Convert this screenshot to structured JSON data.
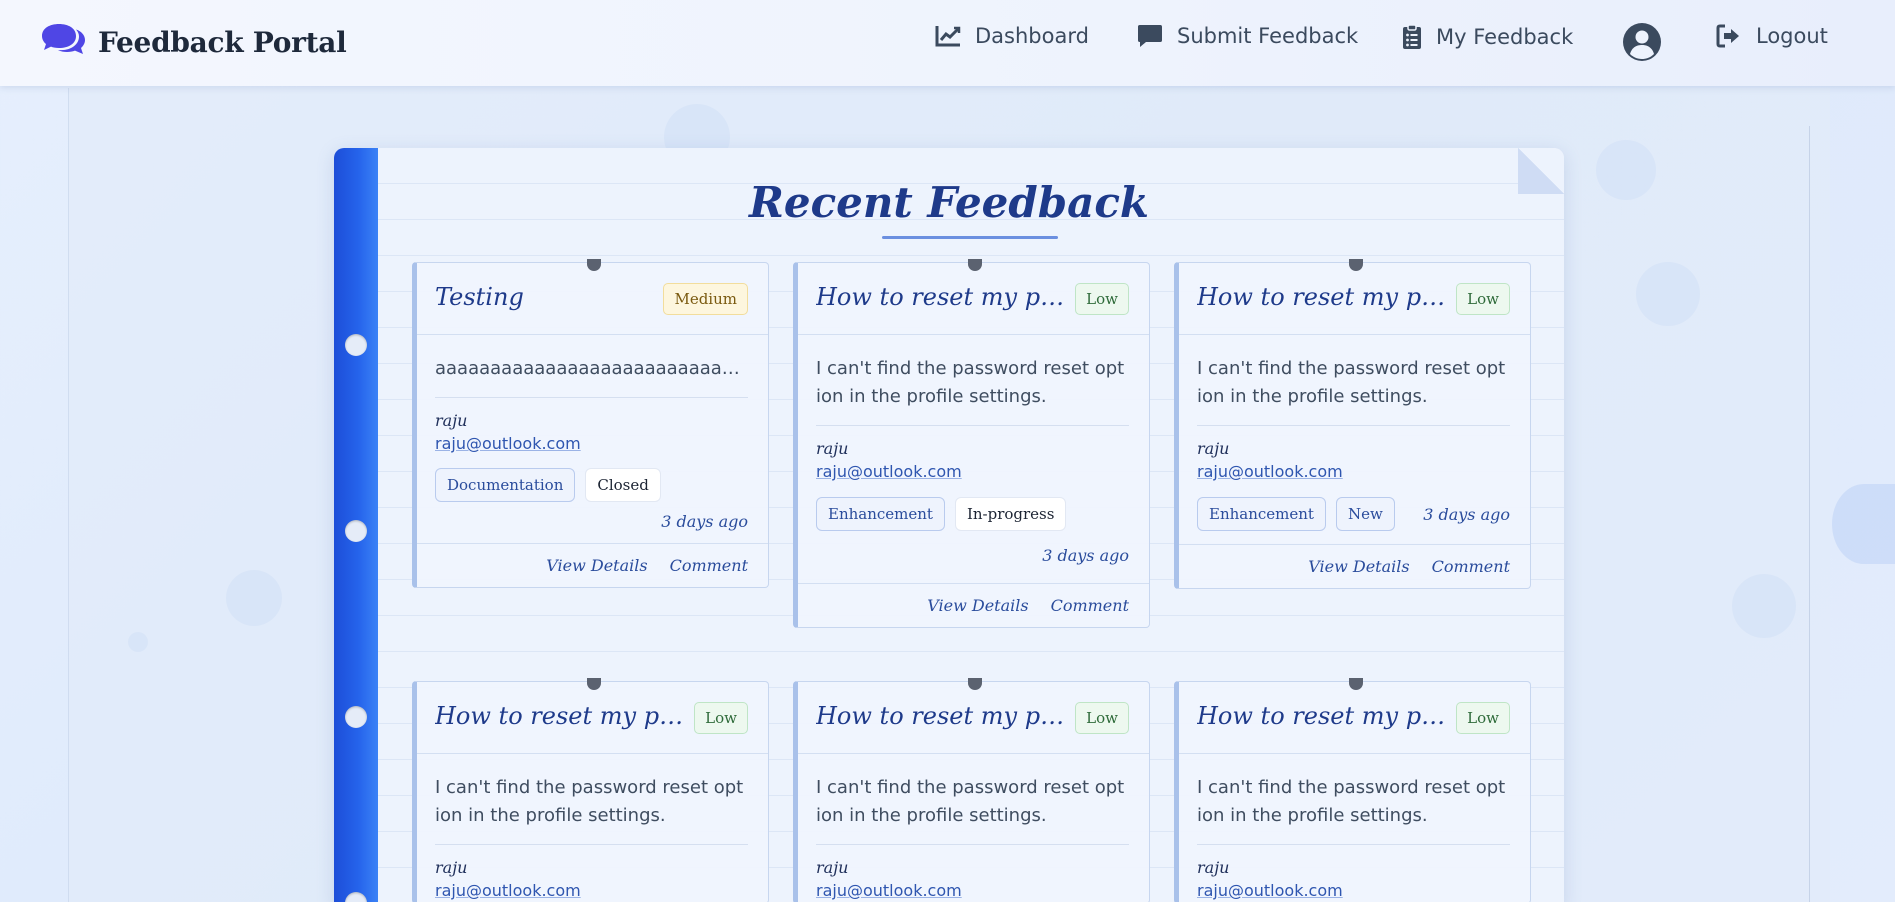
{
  "navbar": {
    "brand": "Feedback Portal",
    "brand_icon": "comments-icon",
    "items": [
      {
        "label": "Dashboard",
        "icon": "chart-line-icon"
      },
      {
        "label": "Submit Feedback",
        "icon": "comment-icon"
      },
      {
        "label": "My Feedback",
        "icon": "clipboard-list-icon"
      },
      {
        "label": "Logout",
        "icon": "sign-out-icon"
      }
    ],
    "avatar_icon": "user-circle-icon"
  },
  "page": {
    "title": "Recent Feedback"
  },
  "cards": [
    {
      "title": "Testing",
      "priority": "Medium",
      "description": "aaaaaaaaaaaaaaaaaaaaaaaaaaaaaaaaaaaaaa...",
      "author": "raju",
      "email": "raju@outlook.com",
      "category": "Documentation",
      "status": "Closed",
      "date": "3 days ago",
      "view_label": "View Details",
      "comment_label": "Comment"
    },
    {
      "title": "How to reset my password?",
      "priority": "Low",
      "description": "I can't find the password reset option in the profile settings.",
      "author": "raju",
      "email": "raju@outlook.com",
      "category": "Enhancement",
      "status": "In-progress",
      "date": "3 days ago",
      "view_label": "View Details",
      "comment_label": "Comment"
    },
    {
      "title": "How to reset my password?",
      "priority": "Low",
      "description": "I can't find the password reset option in the profile settings.",
      "author": "raju",
      "email": "raju@outlook.com",
      "category": "Enhancement",
      "status": "New",
      "date": "3 days ago",
      "view_label": "View Details",
      "comment_label": "Comment"
    },
    {
      "title": "How to reset my password?",
      "priority": "Low",
      "description": "I can't find the password reset option in the profile settings.",
      "author": "raju",
      "email": "raju@outlook.com"
    },
    {
      "title": "How to reset my password?",
      "priority": "Low",
      "description": "I can't find the password reset option in the profile settings.",
      "author": "raju",
      "email": "raju@outlook.com"
    },
    {
      "title": "How to reset my password?",
      "priority": "Low",
      "description": "I can't find the password reset option in the profile settings.",
      "author": "raju",
      "email": "raju@outlook.com"
    }
  ],
  "colors": {
    "accent": "#2563eb",
    "title": "#1e3a8a",
    "priority_medium_bg": "#fdf6de",
    "priority_low_bg": "#edf8ef"
  }
}
